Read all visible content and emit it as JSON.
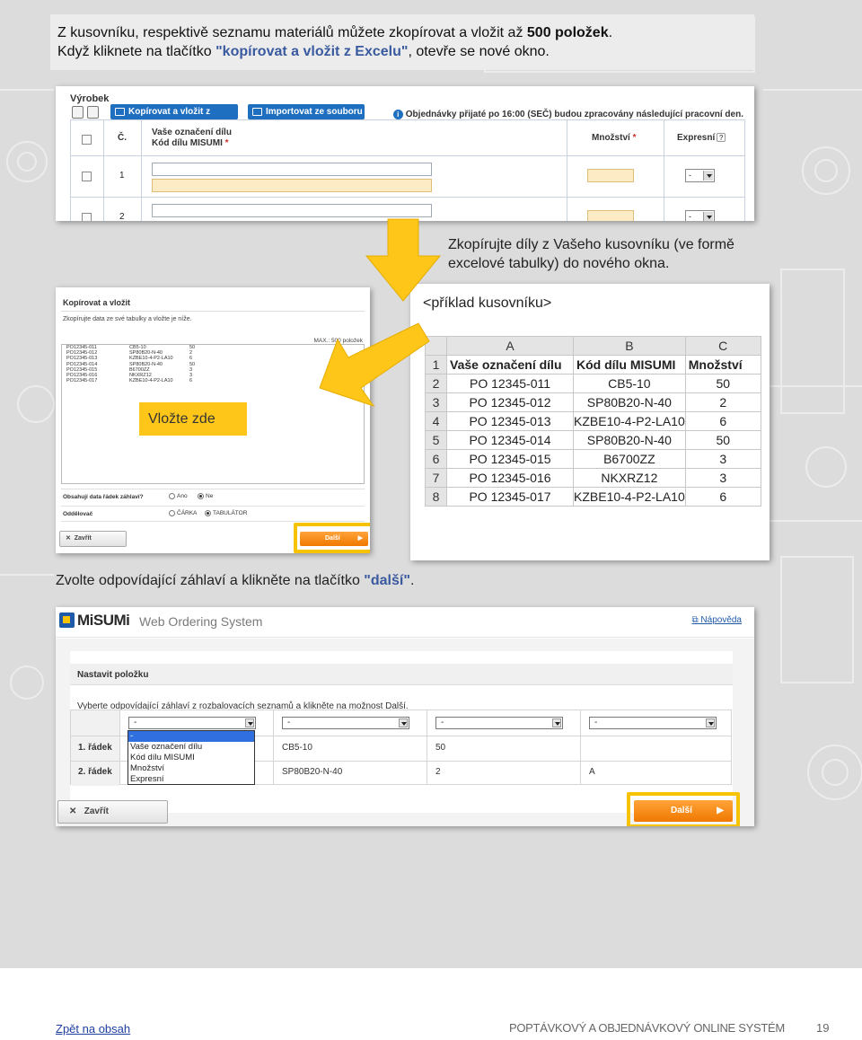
{
  "intro": {
    "line1_prefix": "Z kusovníku,  respektivě seznamu materiálů můžete zkopírovat a vložit až ",
    "line1_bold": "500 položek",
    "line1_suffix": ".",
    "line2_prefix": "Když kliknete na tlačítko ",
    "line2_button": "\"kopírovat a vložit z Excelu\"",
    "line2_suffix": ", otevře se nové okno."
  },
  "screen1": {
    "title": "Výrobek",
    "copy_paste_button": "Kopírovat a vložit z Excelu",
    "import_button": "Importovat ze souboru",
    "info_icon_glyph": "i",
    "info_text": "Objednávky přijaté po 16:00 (SEČ) budou zpracovány následující pracovní den.",
    "col_no": "Č.",
    "col_designation": "Vaše označení dílu",
    "col_part_no": "Kód dílu MISUMI",
    "required_mark": "*",
    "col_quantity": "Množství",
    "col_express": "Expresní",
    "help_glyph": "?",
    "rows": [
      {
        "no": "1",
        "express": "-"
      },
      {
        "no": "2",
        "express": "-"
      }
    ]
  },
  "note_copy": {
    "line1": "Zkopírujte  díly z Vašeho kusovníku (ve formě",
    "line2": "excelové tabulky) do nového okna."
  },
  "popup": {
    "title": "Kopírovat a vložit",
    "subtitle": "Zkopírujte data ze své tabulky a vložte je níže.",
    "max": "MAX.: 500 položek",
    "pasted_lines": [
      [
        "PO12345-011",
        "CB5-10",
        "50"
      ],
      [
        "PO12345-012",
        "SP80B20-N-40",
        "2"
      ],
      [
        "PO12345-013",
        "KZBE10-4-P2-LA10",
        "6"
      ],
      [
        "PO12345-014",
        "SP80B20-N-40",
        "50"
      ],
      [
        "PO12345-015",
        "B6700ZZ",
        "3"
      ],
      [
        "PO12345-016",
        "NKXRZ12",
        "3"
      ],
      [
        "PO12345-017",
        "KZBE10-4-P2-LA10",
        "6"
      ]
    ],
    "header_question": "Obsahují data řádek záhlaví?",
    "opt_yes": "Ano",
    "opt_no": "Ne",
    "separator_label": "Oddělovač",
    "opt_comma": "ČÁRKA",
    "opt_tab": "TABULÁTOR",
    "close_icon_glyph": "✕",
    "close_button": "Zavřít",
    "next_button": "Další",
    "next_arrow_glyph": "▶"
  },
  "paste_here": "Vložte zde",
  "excel": {
    "label": "<příklad kusovníku>",
    "columns": [
      "A",
      "B",
      "C"
    ],
    "rows": [
      {
        "n": "1",
        "a": "Vaše označení dílu",
        "b": "Kód dílu MISUMI",
        "c": "Množství"
      },
      {
        "n": "2",
        "a": "PO 12345-011",
        "b": "CB5-10",
        "c": "50"
      },
      {
        "n": "3",
        "a": "PO 12345-012",
        "b": "SP80B20-N-40",
        "c": "2"
      },
      {
        "n": "4",
        "a": "PO 12345-013",
        "b": "KZBE10-4-P2-LA10",
        "c": "6"
      },
      {
        "n": "5",
        "a": "PO 12345-014",
        "b": "SP80B20-N-40",
        "c": "50"
      },
      {
        "n": "6",
        "a": "PO 12345-015",
        "b": "B6700ZZ",
        "c": "3"
      },
      {
        "n": "7",
        "a": "PO 12345-016",
        "b": "NKXRZ12",
        "c": "3"
      },
      {
        "n": "8",
        "a": "PO 12345-017",
        "b": "KZBE10-4-P2-LA10",
        "c": "6"
      }
    ]
  },
  "choose_header": {
    "prefix": "Zvolte  odpovídající  záhlaví  a  klikněte na tlačítko ",
    "button": "\"další\"",
    "suffix": "."
  },
  "screen4": {
    "brand": "MiSUMi",
    "system": "Web Ordering System",
    "help_icon_glyph": "⧉",
    "help_link": "Nápověda",
    "section": "Nastavit položku",
    "hint": "Vyberte odpovídající záhlaví z rozbalovacích seznamů a klikněte na možnost Další.",
    "selects": [
      "-",
      "-",
      "-",
      "-"
    ],
    "row_labels": [
      "1. řádek",
      "2. řádek"
    ],
    "row1": [
      "CB5-10",
      "50",
      ""
    ],
    "row2": [
      "SP80B20-N-40",
      "2",
      "A"
    ],
    "dropdown_options": [
      "-",
      "Vaše označení dílu",
      "Kód dílu MISUMI",
      "Množství",
      "Expresní"
    ],
    "close_icon_glyph": "✕",
    "close_button": "Zavřít",
    "next_button": "Další",
    "next_arrow_glyph": "▶"
  },
  "footer": {
    "back_link": "Zpět na obsah",
    "doc_title": "POPTÁVKOVÝ A OBJEDNÁVKOVÝ ONLINE SYSTÉM",
    "page": "19"
  },
  "colors": {
    "highlight_yellow": "#f7c300",
    "arrow_yellow": "#ffc61a",
    "button_blue": "#1f6fc0",
    "button_orange": "#f07800",
    "text_emphasis_blue": "#3a5aa0"
  }
}
